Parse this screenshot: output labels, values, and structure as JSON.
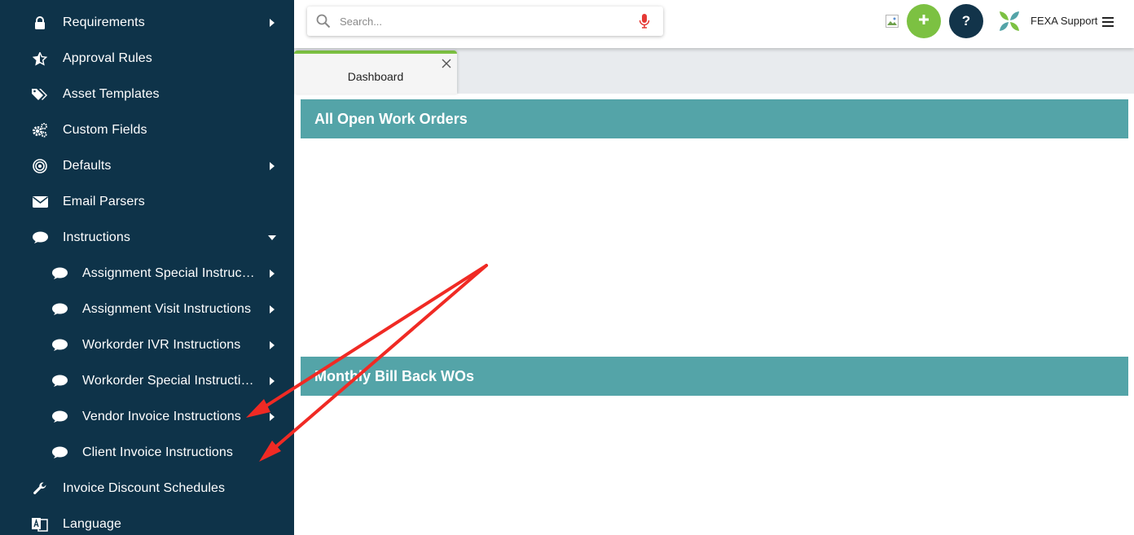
{
  "sidebar": {
    "items": [
      {
        "label": "Requirements",
        "icon": "lock-icon",
        "caret": "right",
        "sub": false
      },
      {
        "label": "Approval Rules",
        "icon": "star-half-icon",
        "caret": "",
        "sub": false
      },
      {
        "label": "Asset Templates",
        "icon": "tags-icon",
        "caret": "",
        "sub": false
      },
      {
        "label": "Custom Fields",
        "icon": "gears-icon",
        "caret": "",
        "sub": false
      },
      {
        "label": "Defaults",
        "icon": "target-icon",
        "caret": "right",
        "sub": false
      },
      {
        "label": "Email Parsers",
        "icon": "envelope-icon",
        "caret": "",
        "sub": false
      },
      {
        "label": "Instructions",
        "icon": "comment-icon",
        "caret": "down",
        "sub": false
      },
      {
        "label": "Assignment Special Instructions",
        "icon": "comment-icon",
        "caret": "right",
        "sub": true
      },
      {
        "label": "Assignment Visit Instructions",
        "icon": "comment-icon",
        "caret": "right",
        "sub": true
      },
      {
        "label": "Workorder IVR Instructions",
        "icon": "comment-icon",
        "caret": "right",
        "sub": true
      },
      {
        "label": "Workorder Special Instructions",
        "icon": "comment-icon",
        "caret": "right",
        "sub": true
      },
      {
        "label": "Vendor Invoice Instructions",
        "icon": "comment-icon",
        "caret": "right",
        "sub": true
      },
      {
        "label": "Client Invoice Instructions",
        "icon": "comment-icon",
        "caret": "",
        "sub": true
      },
      {
        "label": "Invoice Discount Schedules",
        "icon": "wrench-icon",
        "caret": "",
        "sub": false
      },
      {
        "label": "Language",
        "icon": "language-icon",
        "caret": "",
        "sub": false
      }
    ]
  },
  "topbar": {
    "search_placeholder": "Search...",
    "search_value": "",
    "add_icon": "plus-icon",
    "help_label": "?",
    "user_name": "FEXA Support"
  },
  "tabs": [
    {
      "label": "Dashboard",
      "active": true
    }
  ],
  "panels": [
    {
      "title": "All Open Work Orders"
    },
    {
      "title": "Monthly Bill Back WOs"
    }
  ],
  "colors": {
    "sidebar_bg": "#0e3349",
    "accent_green": "#7cc142",
    "panel_header": "#54a4a8",
    "help_button": "#12344a",
    "mic_red": "#e53935",
    "annotation_red": "#f02a24"
  }
}
